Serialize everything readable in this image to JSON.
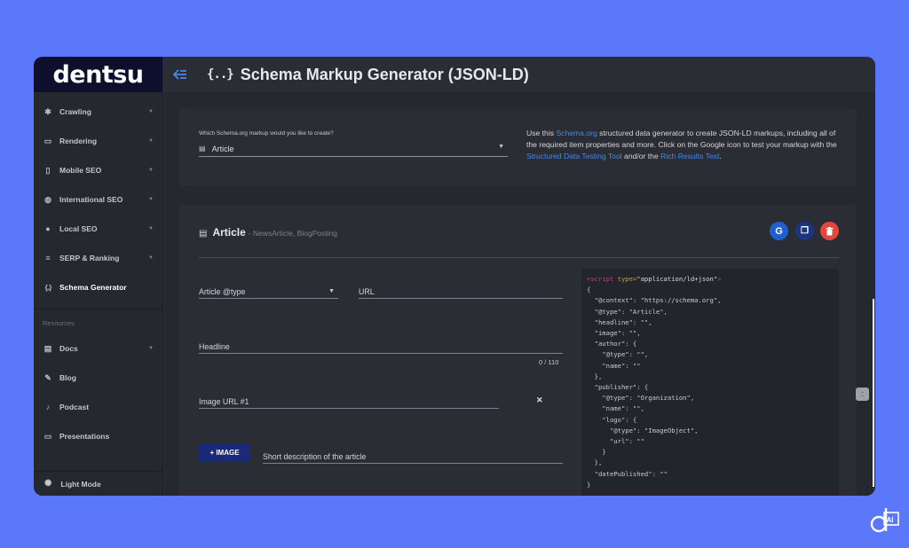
{
  "brand": {
    "logo": "dentsu",
    "corner_mark": "d AI"
  },
  "header": {
    "back_icon": "back-arrow-icon",
    "title_icon": "{..}",
    "title": "Schema Markup Generator (JSON-LD)"
  },
  "sidebar": {
    "items": [
      {
        "label": "Crawling",
        "icon": "bug-icon",
        "glyph": "✱"
      },
      {
        "label": "Rendering",
        "icon": "monitor-icon",
        "glyph": "▭"
      },
      {
        "label": "Mobile SEO",
        "icon": "mobile-icon",
        "glyph": "▯"
      },
      {
        "label": "International SEO",
        "icon": "globe-icon",
        "glyph": "◍"
      },
      {
        "label": "Local SEO",
        "icon": "pin-icon",
        "glyph": "●"
      },
      {
        "label": "SERP & Ranking",
        "icon": "list-icon",
        "glyph": "≡"
      },
      {
        "label": "Schema Generator",
        "icon": "braces-icon",
        "glyph": "{..}"
      }
    ],
    "resources_heading": "Resources",
    "resources": [
      {
        "label": "Docs",
        "icon": "docs-icon",
        "glyph": "▤"
      },
      {
        "label": "Blog",
        "icon": "pencil-icon",
        "glyph": "✎"
      },
      {
        "label": "Podcast",
        "icon": "mic-icon",
        "glyph": "♪"
      },
      {
        "label": "Presentations",
        "icon": "easel-icon",
        "glyph": "▭"
      }
    ],
    "light_mode": {
      "label": "Light Mode",
      "glyph": "✺"
    }
  },
  "selector": {
    "question": "Which Schema.org markup would you like to create?",
    "value": "Article",
    "icon_glyph": "▤"
  },
  "info": {
    "t1": "Use this ",
    "link1": "Schema.org",
    "t2": " structured data generator to create JSON-LD markups, including all of the required item properties and more. Click on the Google icon to test your markup with the ",
    "link2": "Structured Data Testing Tool",
    "t3": " and/or the ",
    "link3": "Rich Results Test",
    "t4": "."
  },
  "article": {
    "title": "Article",
    "subtitle": "- NewsArticle, BlogPosting",
    "icon_glyph": "▤",
    "google_glyph": "G",
    "copy_glyph": "❐",
    "delete_glyph": "🗑"
  },
  "form": {
    "type_label": "Article @type",
    "url_label": "URL",
    "headline_label": "Headline",
    "headline_counter": "0 / 110",
    "image_url_label": "Image URL #1",
    "remove_glyph": "✕",
    "image_button": "+ IMAGE",
    "description_label": "Short description of the article"
  },
  "code": {
    "script_open_tag": "<script",
    "script_attr": " type=",
    "script_type": "\"application/ld+json\"",
    "script_close": ">",
    "lines": [
      "{",
      "  \"@context\": \"https://schema.org\",",
      "  \"@type\": \"Article\",",
      "  \"headline\": \"\",",
      "  \"image\": \"\",",
      "  \"author\": {",
      "    \"@type\": \"\",",
      "    \"name\": \"\"",
      "  },",
      "  \"publisher\": {",
      "    \"@type\": \"Organization\",",
      "    \"name\": \"\",",
      "    \"logo\": {",
      "      \"@type\": \"ImageObject\",",
      "      \"url\": \"\"",
      "    }",
      "  },",
      "  \"datePublished\": \"\"",
      "}"
    ]
  },
  "scroll_handle_glyph": "⁚⁚",
  "colors": {
    "background": "#5b78fb",
    "panel": "#25282e",
    "card": "#2a2d33",
    "accent": "#3d8bf2",
    "logo_bg": "#0e0f2c",
    "delete": "#e5453f",
    "button": "#1b2a78"
  }
}
